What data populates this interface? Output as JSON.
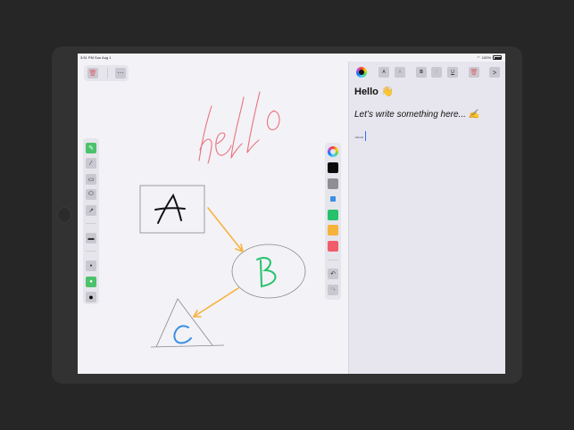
{
  "status_bar": {
    "time": "3:51 PM",
    "date": "Sun Aug 1",
    "battery": "100%"
  },
  "canvas": {
    "hello_text": "hello",
    "node_a": "A",
    "node_b": "B",
    "node_c": "C"
  },
  "top_toolbar": {
    "delete_icon": "trash-icon",
    "more_label": "⋯"
  },
  "tools": [
    {
      "name": "pen-tool",
      "icon": "pen-icon",
      "active": true
    },
    {
      "name": "line-tool",
      "icon": "line-icon"
    },
    {
      "name": "rectangle-tool",
      "icon": "rectangle-icon"
    },
    {
      "name": "ellipse-tool",
      "icon": "ellipse-icon"
    },
    {
      "name": "arrow-tool",
      "icon": "arrow-icon"
    },
    {
      "name": "eraser-tool",
      "icon": "eraser-icon"
    },
    {
      "name": "small-brush",
      "icon": "small-dot-icon"
    },
    {
      "name": "medium-brush",
      "icon": "medium-dot-icon",
      "active": true
    },
    {
      "name": "large-brush",
      "icon": "large-dot-icon"
    }
  ],
  "colors": {
    "black": "#0a0a0a",
    "gray": "#8e8e93",
    "blue": "#3b8fe0",
    "green": "#25c26b",
    "orange": "#f7b23b",
    "red": "#f05c6a",
    "accent_green": "#4cc26b"
  },
  "format_bar": {
    "font_small": "A",
    "font_large": "A",
    "bold": "B",
    "italic": "I",
    "underline": "U",
    "next": ">"
  },
  "note": {
    "title": "Hello 👋",
    "line1": "Let’s write something here... ✍️",
    "line2": "........"
  }
}
